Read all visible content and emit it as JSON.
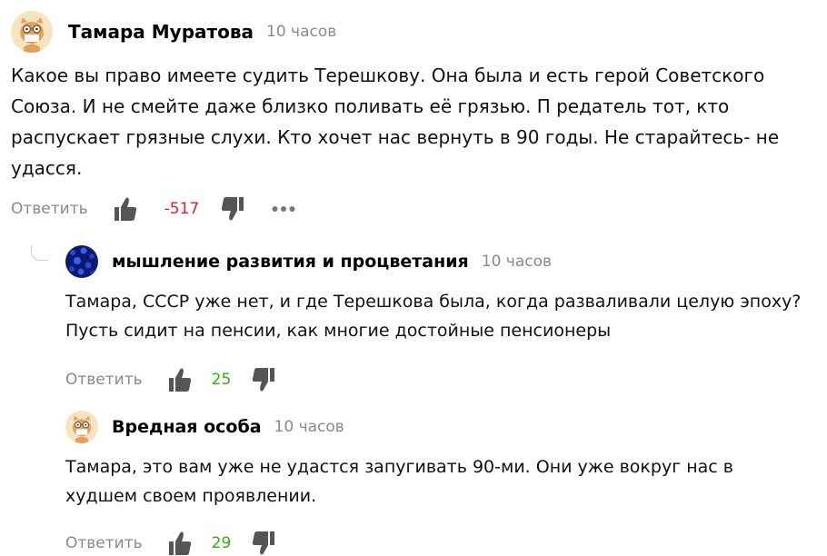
{
  "comments": [
    {
      "author": "Тамара Муратова",
      "time": "10 часов",
      "text": "Какое вы право имеете судить Терешкову. Она была и есть герой Советского Союза. И не смейте даже близко поливать её грязью. П редатель тот, кто распускает грязные слухи. Кто хочет нас вернуть в 90 годы. Не старайтесь- не удасся.",
      "reply_label": "Ответить",
      "score": "-517",
      "avatar_icon": "cat-mask-avatar-icon"
    },
    {
      "author": "мышление развития и процветания",
      "time": "10 часов",
      "text": "Тамара, СССР уже нет, и где Терешкова была, когда разваливали целую эпоху? Пусть сидит на пенсии, как многие достойные пенсионеры",
      "reply_label": "Ответить",
      "score": "25",
      "avatar_icon": "blue-flowers-avatar-icon"
    },
    {
      "author": "Вредная особа",
      "time": "10 часов",
      "text": "Тамара, это вам уже не удастся запугивать 90-ми. Они уже вокруг нас в худшем своем проявлении.",
      "reply_label": "Ответить",
      "score": "29",
      "avatar_icon": "cat-mask-avatar-icon"
    }
  ],
  "colors": {
    "negative_score": "#e31e1e",
    "positive_score": "#2db00d",
    "muted_text": "#8a8a8a",
    "icon": "#555555"
  }
}
